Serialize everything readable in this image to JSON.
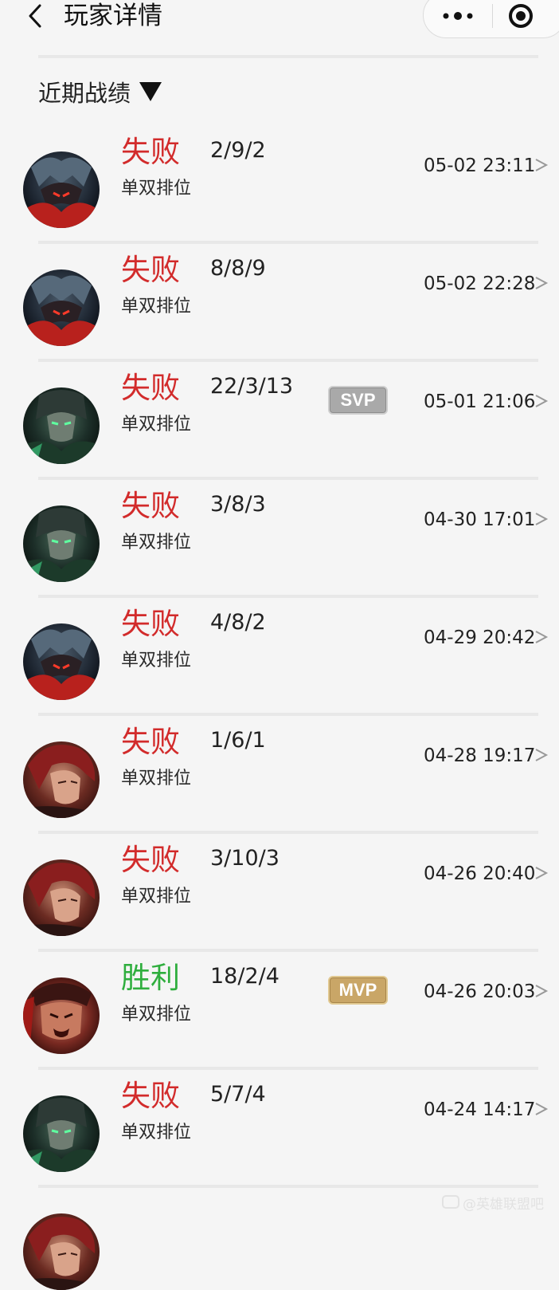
{
  "header": {
    "title": "玩家详情"
  },
  "section": {
    "title": "近期战绩"
  },
  "matches": [
    {
      "result": "失败",
      "win": false,
      "kda": "2/9/2",
      "mode": "单双排位",
      "time": "05-02 23:11",
      "badge": "",
      "avatar": "aatrox"
    },
    {
      "result": "失败",
      "win": false,
      "kda": "8/8/9",
      "mode": "单双排位",
      "time": "05-02 22:28",
      "badge": "",
      "avatar": "aatrox"
    },
    {
      "result": "失败",
      "win": false,
      "kda": "22/3/13",
      "mode": "单双排位",
      "time": "05-01 21:06",
      "badge": "SVP",
      "avatar": "green"
    },
    {
      "result": "失败",
      "win": false,
      "kda": "3/8/3",
      "mode": "单双排位",
      "time": "04-30 17:01",
      "badge": "",
      "avatar": "green"
    },
    {
      "result": "失败",
      "win": false,
      "kda": "4/8/2",
      "mode": "单双排位",
      "time": "04-29 20:42",
      "badge": "",
      "avatar": "aatrox"
    },
    {
      "result": "失败",
      "win": false,
      "kda": "1/6/1",
      "mode": "单双排位",
      "time": "04-28 19:17",
      "badge": "",
      "avatar": "redhair"
    },
    {
      "result": "失败",
      "win": false,
      "kda": "3/10/3",
      "mode": "单双排位",
      "time": "04-26 20:40",
      "badge": "",
      "avatar": "redhair"
    },
    {
      "result": "胜利",
      "win": true,
      "kda": "18/2/4",
      "mode": "单双排位",
      "time": "04-26 20:03",
      "badge": "MVP",
      "avatar": "darius"
    },
    {
      "result": "失败",
      "win": false,
      "kda": "5/7/4",
      "mode": "单双排位",
      "time": "04-24 14:17",
      "badge": "",
      "avatar": "green"
    }
  ],
  "colors": {
    "loss": "#d22b2b",
    "win": "#2fae3e"
  },
  "watermark": "@英雄联盟吧"
}
